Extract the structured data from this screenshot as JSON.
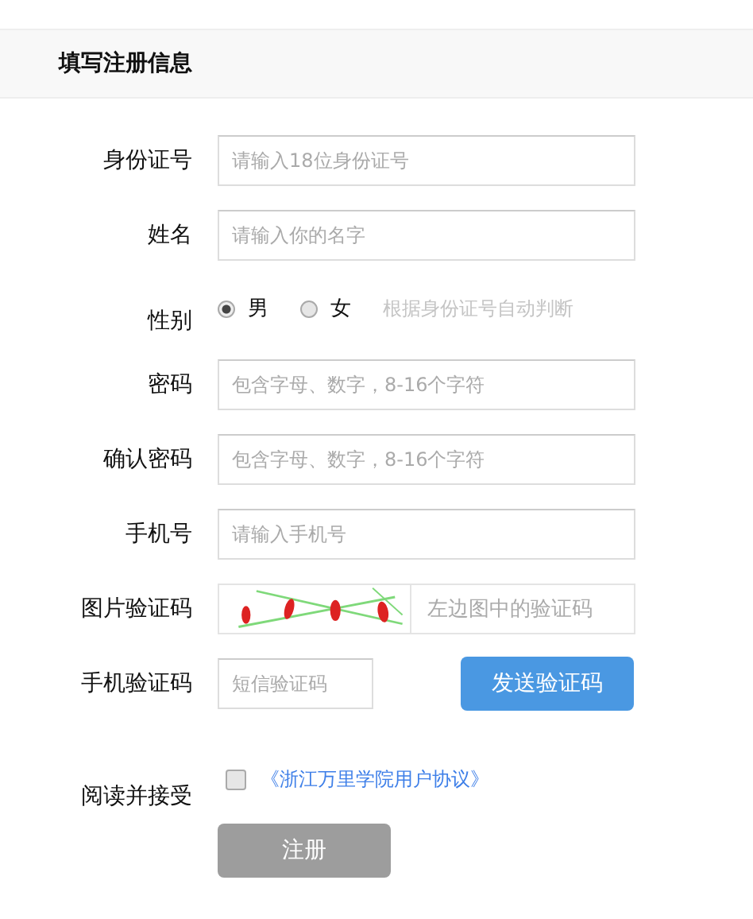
{
  "title": "填写注册信息",
  "fields": [
    {
      "kind": "text",
      "label": "身份证号",
      "placeholder": "请输入18位身份证号"
    },
    {
      "kind": "text",
      "label": "姓名",
      "placeholder": "请输入你的名字"
    },
    {
      "kind": "gender",
      "label": "性别",
      "options": [
        {
          "label": "男",
          "selected": true
        },
        {
          "label": "女",
          "selected": false
        }
      ],
      "hint": "根据身份证号自动判断"
    },
    {
      "kind": "text",
      "label": "密码",
      "placeholder": "包含字母、数字，8-16个字符"
    },
    {
      "kind": "text",
      "label": "确认密码",
      "placeholder": "包含字母、数字，8-16个字符"
    },
    {
      "kind": "text",
      "label": "手机号",
      "placeholder": "请输入手机号"
    },
    {
      "kind": "captcha",
      "label": "图片验证码",
      "placeholder": "左边图中的验证码"
    },
    {
      "kind": "sms",
      "label": "手机验证码",
      "placeholder": "短信验证码",
      "button": "发送验证码"
    }
  ],
  "agreement": {
    "label": "阅读并接受",
    "checked": false,
    "link": "《浙江万里学院用户协议》"
  },
  "submit": {
    "label": "注册",
    "disabled": true
  }
}
